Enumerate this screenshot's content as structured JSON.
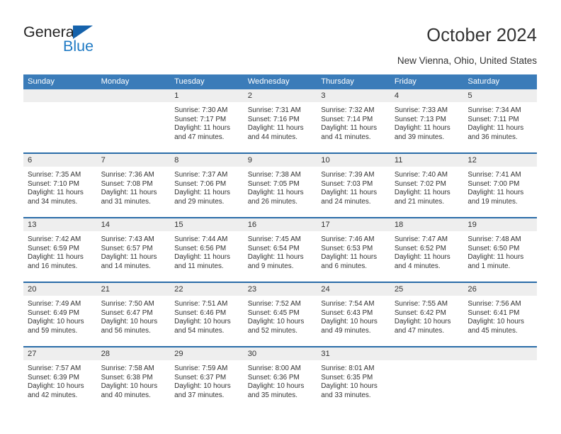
{
  "brand": {
    "name_part1": "General",
    "name_part2": "Blue",
    "triangle_icon": "triangle-icon"
  },
  "header": {
    "title": "October 2024",
    "location": "New Vienna, Ohio, United States"
  },
  "colors": {
    "header_blue": "#3b7cb9",
    "row_divider_blue": "#2a6ca8",
    "daynum_band": "#eeeeee",
    "brand_blue": "#1f7ac4",
    "text": "#333333"
  },
  "weekday_headers": [
    "Sunday",
    "Monday",
    "Tuesday",
    "Wednesday",
    "Thursday",
    "Friday",
    "Saturday"
  ],
  "weeks": [
    [
      {
        "day": "",
        "lines": []
      },
      {
        "day": "",
        "lines": []
      },
      {
        "day": "1",
        "lines": [
          "Sunrise: 7:30 AM",
          "Sunset: 7:17 PM",
          "Daylight: 11 hours",
          "and 47 minutes."
        ]
      },
      {
        "day": "2",
        "lines": [
          "Sunrise: 7:31 AM",
          "Sunset: 7:16 PM",
          "Daylight: 11 hours",
          "and 44 minutes."
        ]
      },
      {
        "day": "3",
        "lines": [
          "Sunrise: 7:32 AM",
          "Sunset: 7:14 PM",
          "Daylight: 11 hours",
          "and 41 minutes."
        ]
      },
      {
        "day": "4",
        "lines": [
          "Sunrise: 7:33 AM",
          "Sunset: 7:13 PM",
          "Daylight: 11 hours",
          "and 39 minutes."
        ]
      },
      {
        "day": "5",
        "lines": [
          "Sunrise: 7:34 AM",
          "Sunset: 7:11 PM",
          "Daylight: 11 hours",
          "and 36 minutes."
        ]
      }
    ],
    [
      {
        "day": "6",
        "lines": [
          "Sunrise: 7:35 AM",
          "Sunset: 7:10 PM",
          "Daylight: 11 hours",
          "and 34 minutes."
        ]
      },
      {
        "day": "7",
        "lines": [
          "Sunrise: 7:36 AM",
          "Sunset: 7:08 PM",
          "Daylight: 11 hours",
          "and 31 minutes."
        ]
      },
      {
        "day": "8",
        "lines": [
          "Sunrise: 7:37 AM",
          "Sunset: 7:06 PM",
          "Daylight: 11 hours",
          "and 29 minutes."
        ]
      },
      {
        "day": "9",
        "lines": [
          "Sunrise: 7:38 AM",
          "Sunset: 7:05 PM",
          "Daylight: 11 hours",
          "and 26 minutes."
        ]
      },
      {
        "day": "10",
        "lines": [
          "Sunrise: 7:39 AM",
          "Sunset: 7:03 PM",
          "Daylight: 11 hours",
          "and 24 minutes."
        ]
      },
      {
        "day": "11",
        "lines": [
          "Sunrise: 7:40 AM",
          "Sunset: 7:02 PM",
          "Daylight: 11 hours",
          "and 21 minutes."
        ]
      },
      {
        "day": "12",
        "lines": [
          "Sunrise: 7:41 AM",
          "Sunset: 7:00 PM",
          "Daylight: 11 hours",
          "and 19 minutes."
        ]
      }
    ],
    [
      {
        "day": "13",
        "lines": [
          "Sunrise: 7:42 AM",
          "Sunset: 6:59 PM",
          "Daylight: 11 hours",
          "and 16 minutes."
        ]
      },
      {
        "day": "14",
        "lines": [
          "Sunrise: 7:43 AM",
          "Sunset: 6:57 PM",
          "Daylight: 11 hours",
          "and 14 minutes."
        ]
      },
      {
        "day": "15",
        "lines": [
          "Sunrise: 7:44 AM",
          "Sunset: 6:56 PM",
          "Daylight: 11 hours",
          "and 11 minutes."
        ]
      },
      {
        "day": "16",
        "lines": [
          "Sunrise: 7:45 AM",
          "Sunset: 6:54 PM",
          "Daylight: 11 hours",
          "and 9 minutes."
        ]
      },
      {
        "day": "17",
        "lines": [
          "Sunrise: 7:46 AM",
          "Sunset: 6:53 PM",
          "Daylight: 11 hours",
          "and 6 minutes."
        ]
      },
      {
        "day": "18",
        "lines": [
          "Sunrise: 7:47 AM",
          "Sunset: 6:52 PM",
          "Daylight: 11 hours",
          "and 4 minutes."
        ]
      },
      {
        "day": "19",
        "lines": [
          "Sunrise: 7:48 AM",
          "Sunset: 6:50 PM",
          "Daylight: 11 hours",
          "and 1 minute."
        ]
      }
    ],
    [
      {
        "day": "20",
        "lines": [
          "Sunrise: 7:49 AM",
          "Sunset: 6:49 PM",
          "Daylight: 10 hours",
          "and 59 minutes."
        ]
      },
      {
        "day": "21",
        "lines": [
          "Sunrise: 7:50 AM",
          "Sunset: 6:47 PM",
          "Daylight: 10 hours",
          "and 56 minutes."
        ]
      },
      {
        "day": "22",
        "lines": [
          "Sunrise: 7:51 AM",
          "Sunset: 6:46 PM",
          "Daylight: 10 hours",
          "and 54 minutes."
        ]
      },
      {
        "day": "23",
        "lines": [
          "Sunrise: 7:52 AM",
          "Sunset: 6:45 PM",
          "Daylight: 10 hours",
          "and 52 minutes."
        ]
      },
      {
        "day": "24",
        "lines": [
          "Sunrise: 7:54 AM",
          "Sunset: 6:43 PM",
          "Daylight: 10 hours",
          "and 49 minutes."
        ]
      },
      {
        "day": "25",
        "lines": [
          "Sunrise: 7:55 AM",
          "Sunset: 6:42 PM",
          "Daylight: 10 hours",
          "and 47 minutes."
        ]
      },
      {
        "day": "26",
        "lines": [
          "Sunrise: 7:56 AM",
          "Sunset: 6:41 PM",
          "Daylight: 10 hours",
          "and 45 minutes."
        ]
      }
    ],
    [
      {
        "day": "27",
        "lines": [
          "Sunrise: 7:57 AM",
          "Sunset: 6:39 PM",
          "Daylight: 10 hours",
          "and 42 minutes."
        ]
      },
      {
        "day": "28",
        "lines": [
          "Sunrise: 7:58 AM",
          "Sunset: 6:38 PM",
          "Daylight: 10 hours",
          "and 40 minutes."
        ]
      },
      {
        "day": "29",
        "lines": [
          "Sunrise: 7:59 AM",
          "Sunset: 6:37 PM",
          "Daylight: 10 hours",
          "and 37 minutes."
        ]
      },
      {
        "day": "30",
        "lines": [
          "Sunrise: 8:00 AM",
          "Sunset: 6:36 PM",
          "Daylight: 10 hours",
          "and 35 minutes."
        ]
      },
      {
        "day": "31",
        "lines": [
          "Sunrise: 8:01 AM",
          "Sunset: 6:35 PM",
          "Daylight: 10 hours",
          "and 33 minutes."
        ]
      },
      {
        "day": "",
        "lines": []
      },
      {
        "day": "",
        "lines": []
      }
    ]
  ]
}
